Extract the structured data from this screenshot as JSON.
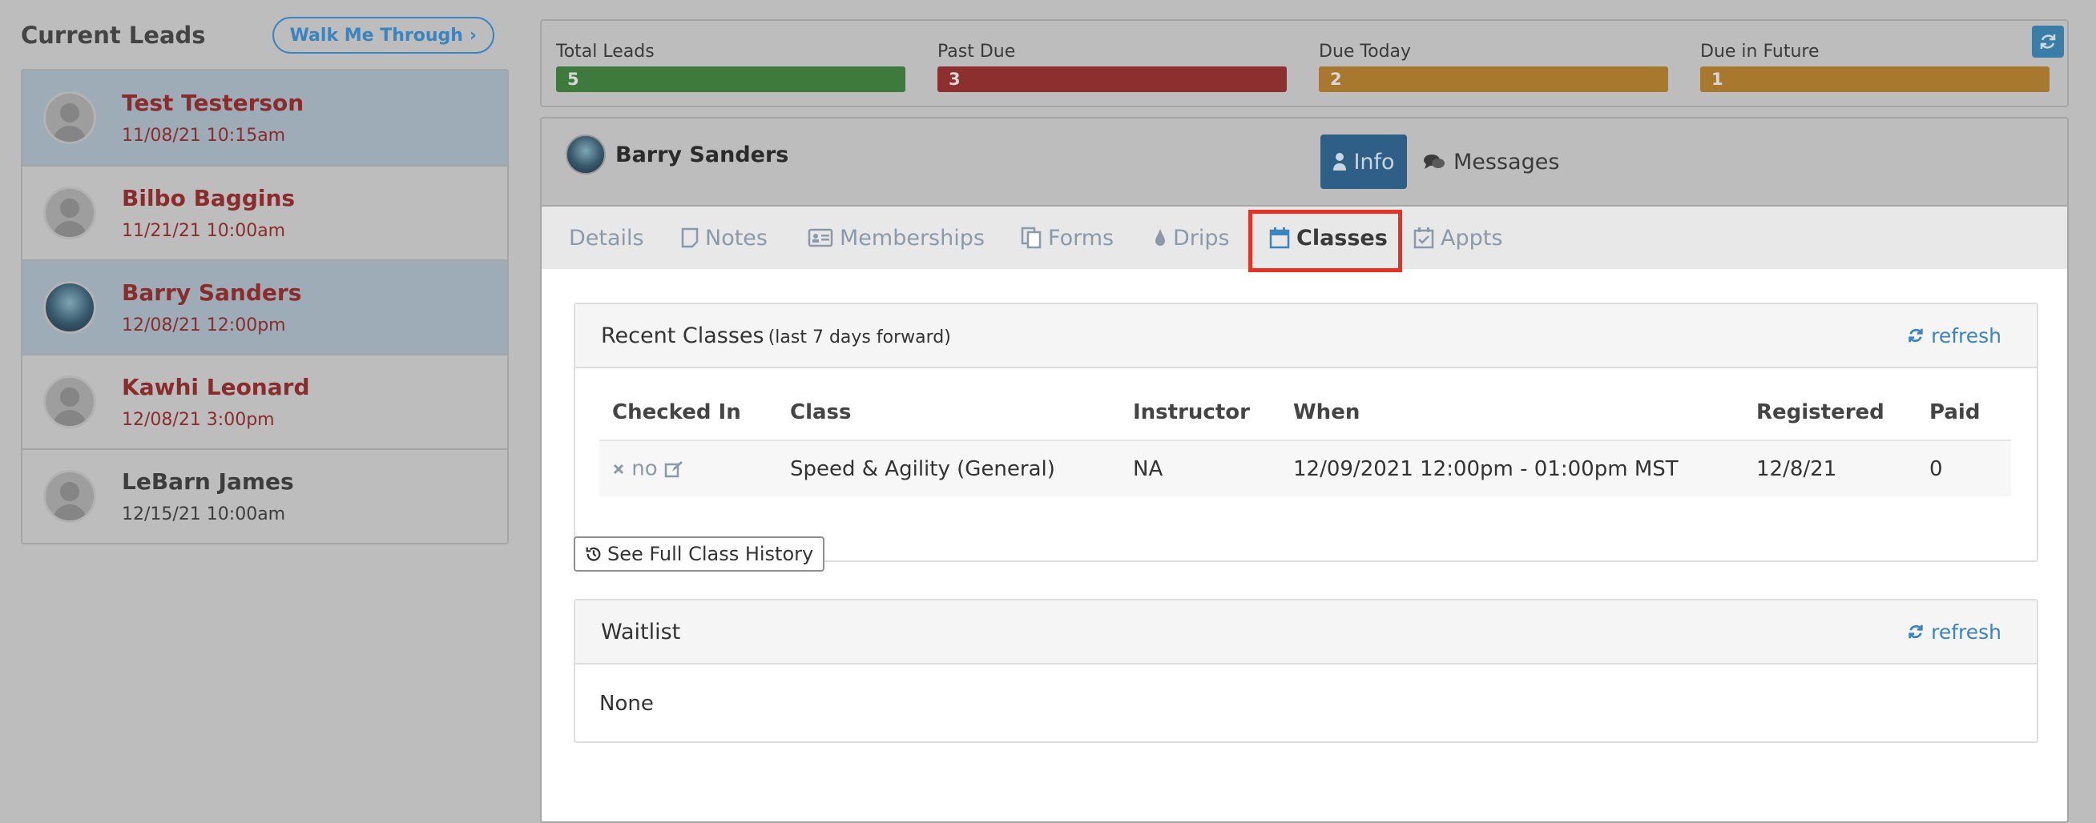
{
  "sidebar": {
    "title": "Current Leads",
    "walk_button": "Walk Me Through",
    "walk_chevron": "›",
    "leads": [
      {
        "name": "Test Testerson",
        "date": "11/08/21 10:15am"
      },
      {
        "name": "Bilbo Baggins",
        "date": "11/21/21 10:00am"
      },
      {
        "name": "Barry Sanders",
        "date": "12/08/21 12:00pm"
      },
      {
        "name": "Kawhi Leonard",
        "date": "12/08/21 3:00pm"
      },
      {
        "name": "LeBarn James",
        "date": "12/15/21 10:00am"
      }
    ]
  },
  "stats": {
    "total_leads": {
      "label": "Total Leads",
      "value": "5"
    },
    "past_due": {
      "label": "Past Due",
      "value": "3"
    },
    "due_today": {
      "label": "Due Today",
      "value": "2"
    },
    "due_future": {
      "label": "Due in Future",
      "value": "1"
    }
  },
  "profile": {
    "name": "Barry Sanders",
    "info_button": "Info",
    "messages_button": "Messages"
  },
  "tabs": {
    "details": "Details",
    "notes": "Notes",
    "memberships": "Memberships",
    "forms": "Forms",
    "drips": "Drips",
    "classes": "Classes",
    "appts": "Appts"
  },
  "recent_classes": {
    "title": "Recent Classes",
    "subtitle": "(last 7 days forward)",
    "refresh": "refresh",
    "columns": [
      "Checked In",
      "Class",
      "Instructor",
      "When",
      "Registered",
      "Paid"
    ],
    "rows": [
      {
        "checked_in": "no",
        "class": "Speed & Agility (General)",
        "instructor": "NA",
        "when": "12/09/2021 12:00pm - 01:00pm MST",
        "registered": "12/8/21",
        "paid": "0"
      }
    ]
  },
  "history_button": "See Full Class History",
  "waitlist": {
    "title": "Waitlist",
    "refresh": "refresh",
    "content": "None"
  },
  "colors": {
    "accent": "#3a84c0",
    "lead_name": "#8a2c2c",
    "highlight": "#e53224"
  }
}
